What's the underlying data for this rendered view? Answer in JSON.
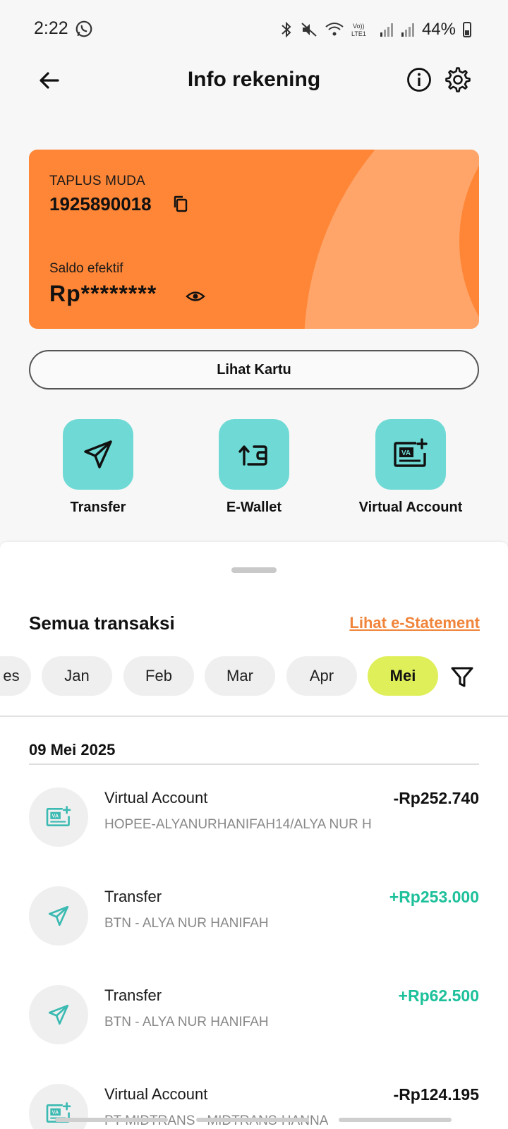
{
  "status_bar": {
    "time": "2:22",
    "battery": "44%"
  },
  "header": {
    "title": "Info rekening"
  },
  "account_card": {
    "type": "TAPLUS MUDA",
    "number": "1925890018",
    "saldo_label": "Saldo efektif",
    "saldo_value": "Rp********"
  },
  "lihat_kartu_label": "Lihat Kartu",
  "quick_actions": [
    {
      "label": "Transfer",
      "icon": "paper-plane-icon"
    },
    {
      "label": "E-Wallet",
      "icon": "wallet-upload-icon"
    },
    {
      "label": "Virtual Account",
      "icon": "va-card-icon"
    }
  ],
  "transactions_section": {
    "title": "Semua transaksi",
    "estatement_link": "Lihat e-Statement",
    "months": [
      "es",
      "Jan",
      "Feb",
      "Mar",
      "Apr",
      "Mei"
    ],
    "active_month": "Mei",
    "date_header": "09 Mei 2025",
    "items": [
      {
        "title": "Virtual Account",
        "desc": "HOPEE-ALYANURHANIFAH14/ALYA NUR H",
        "amount": "-Rp252.740",
        "direction": "out",
        "icon": "va-card-icon"
      },
      {
        "title": "Transfer",
        "desc": "BTN - ALYA NUR HANIFAH",
        "amount": "+Rp253.000",
        "direction": "in",
        "icon": "paper-plane-icon"
      },
      {
        "title": "Transfer",
        "desc": "BTN - ALYA NUR HANIFAH",
        "amount": "+Rp62.500",
        "direction": "in",
        "icon": "paper-plane-icon"
      },
      {
        "title": "Virtual Account",
        "desc": "PT MIDTRANS - MIDTRANS-HANNA",
        "amount": "-Rp124.195",
        "direction": "out",
        "icon": "va-card-icon"
      }
    ]
  },
  "colors": {
    "card_orange": "#ff8636",
    "action_teal": "#6fdad5",
    "active_chip": "#dfef5a",
    "positive_amount": "#1cc09a",
    "link_orange": "#f0843a"
  }
}
